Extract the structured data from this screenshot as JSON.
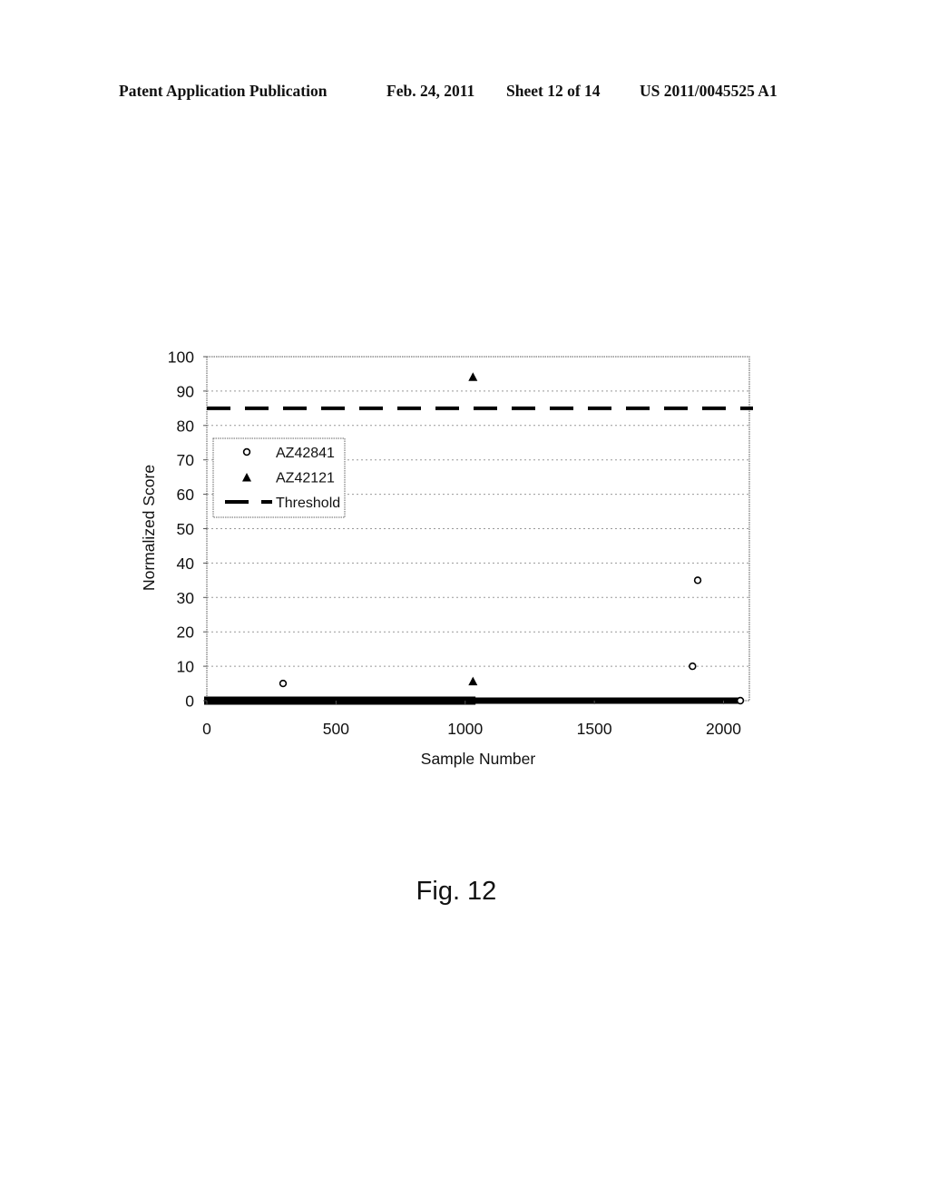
{
  "header": {
    "publication": "Patent Application Publication",
    "date": "Feb. 24, 2011",
    "sheet": "Sheet 12 of 14",
    "number": "US 2011/0045525 A1"
  },
  "figure_caption": "Fig. 12",
  "chart_data": {
    "type": "scatter",
    "title": "",
    "xlabel": "Sample Number",
    "ylabel": "Normalized Score",
    "xlim": [
      0,
      2100
    ],
    "ylim": [
      0,
      100
    ],
    "xticks": [
      0,
      500,
      1000,
      1500,
      2000
    ],
    "yticks": [
      0,
      10,
      20,
      30,
      40,
      50,
      60,
      70,
      80,
      90,
      100
    ],
    "grid": "horizontal-dotted",
    "legend_position": "upper-left",
    "series": [
      {
        "name": "AZ42841",
        "marker": "open-circle",
        "points": [
          [
            295,
            5
          ],
          [
            1880,
            10
          ],
          [
            1900,
            35
          ],
          [
            2065,
            0
          ]
        ],
        "zero_band": {
          "from": 0,
          "to": 2060,
          "value": 0
        }
      },
      {
        "name": "AZ42121",
        "marker": "filled-triangle",
        "points": [
          [
            1030,
            94
          ],
          [
            1030,
            5.5
          ]
        ],
        "zero_band": {
          "from": 0,
          "to": 1040,
          "value": 0
        }
      },
      {
        "name": "Threshold",
        "marker": "dashed-line",
        "value": 85
      }
    ]
  }
}
